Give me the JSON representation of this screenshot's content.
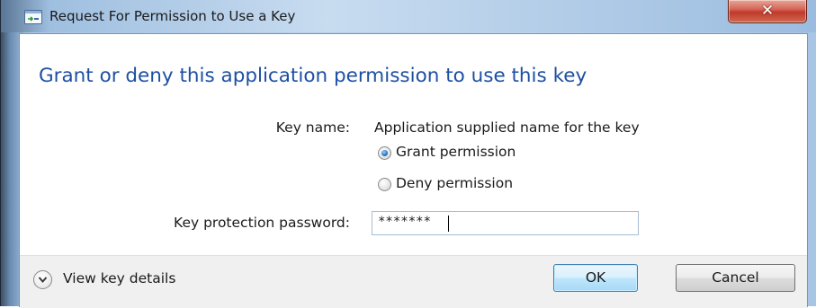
{
  "window": {
    "title": "Request For Permission to Use a Key",
    "close_label": "✕"
  },
  "dialog": {
    "heading": "Grant or deny this application permission to use this key",
    "key_name_label": "Key name:",
    "key_name_value": "Application supplied name for the key",
    "grant_label": "Grant permission",
    "deny_label": "Deny permission",
    "selected_option": "Grant permission",
    "password_label": "Key protection password:",
    "password_value": "*******"
  },
  "footer": {
    "details_label": "View key details",
    "ok_label": "OK",
    "cancel_label": "Cancel"
  },
  "icons": {
    "title_icon": "key-dialog-icon",
    "details_toggle": "chevron-down-icon"
  },
  "colors": {
    "heading": "#1d4fa3",
    "close_button": "#c0392b",
    "default_button_border": "#3c7fb1"
  }
}
